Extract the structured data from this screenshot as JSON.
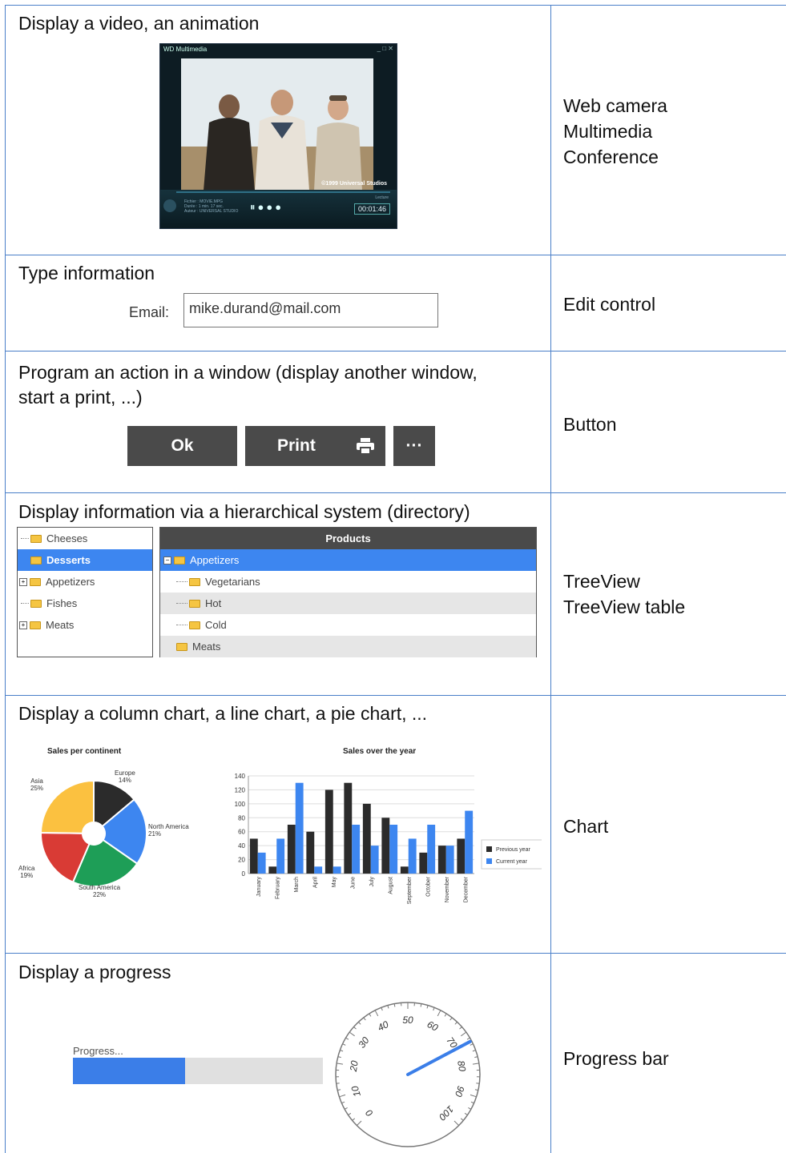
{
  "rows": [
    {
      "description": "Display a video, an animation",
      "use_lines": [
        "Web camera",
        "Multimedia",
        "Conference"
      ]
    },
    {
      "description": "Type information",
      "use_lines": [
        "Edit control"
      ]
    },
    {
      "description_lines": [
        "Program an action in a window (display another window,",
        "start a print, ...)"
      ],
      "use_lines": [
        "Button"
      ]
    },
    {
      "description": "Display information via a hierarchical system (directory)",
      "use_lines": [
        "TreeView",
        "TreeView table"
      ]
    },
    {
      "description": "Display a column chart, a line chart, a pie chart, ...",
      "use_lines": [
        "Chart"
      ]
    },
    {
      "description": "Display a progress",
      "use_lines": [
        "Progress bar"
      ]
    }
  ],
  "video_player": {
    "title": "WD Multimedia",
    "credit": "©1999 Universal Studios",
    "info_lines": [
      "Fichier : MOVIE.MPG",
      "Durée : 1 min. 17 sec.",
      "Auteur : UNIVERSAL STUDIO"
    ],
    "time_caption": "Lecture",
    "time": "00:01:46"
  },
  "email": {
    "label": "Email:",
    "value": "mike.durand@mail.com"
  },
  "buttons": {
    "ok": "Ok",
    "print": "Print",
    "more": "···"
  },
  "treeview": {
    "items": [
      {
        "label": "Cheeses",
        "expander": ""
      },
      {
        "label": "Desserts",
        "expander": "",
        "selected": true
      },
      {
        "label": "Appetizers",
        "expander": "+"
      },
      {
        "label": "Fishes",
        "expander": ""
      },
      {
        "label": "Meats",
        "expander": "+"
      }
    ]
  },
  "treeview_table": {
    "header": "Products",
    "rows": [
      {
        "label": "Appetizers",
        "expander": "−",
        "selected": true
      },
      {
        "label": "Vegetarians"
      },
      {
        "label": "Hot"
      },
      {
        "label": "Cold"
      },
      {
        "label": "Meats"
      }
    ]
  },
  "chart_data": [
    {
      "type": "pie",
      "title": "Sales per continent",
      "categories": [
        "Europe",
        "North America",
        "South America",
        "Africa",
        "Asia"
      ],
      "values": [
        14,
        21,
        22,
        19,
        25
      ],
      "value_labels": [
        "14%",
        "21%",
        "22%",
        "19%",
        "25%"
      ],
      "colors": [
        "#2b2b2b",
        "#3d86f0",
        "#1e9e57",
        "#d93b35",
        "#fbc140"
      ]
    },
    {
      "type": "bar",
      "title": "Sales over the year",
      "categories": [
        "January",
        "February",
        "March",
        "April",
        "May",
        "June",
        "July",
        "August",
        "September",
        "October",
        "November",
        "December"
      ],
      "series": [
        {
          "name": "Previous year",
          "color": "#2b2b2b",
          "values": [
            50,
            10,
            70,
            60,
            120,
            130,
            100,
            80,
            10,
            30,
            40,
            50
          ]
        },
        {
          "name": "Current year",
          "color": "#3d86f0",
          "values": [
            30,
            50,
            130,
            10,
            10,
            70,
            40,
            70,
            50,
            70,
            40,
            90
          ]
        }
      ],
      "ylim": [
        0,
        140
      ],
      "yticks": [
        "0",
        "20",
        "40",
        "60",
        "80",
        "100",
        "120",
        "140"
      ],
      "grid": true,
      "legend": "right"
    }
  ],
  "progress": {
    "label": "Progress...",
    "value": 0.45
  },
  "gauge": {
    "tick_labels": [
      "0",
      "10",
      "20",
      "30",
      "40",
      "50",
      "60",
      "70",
      "80",
      "90",
      "100"
    ],
    "value": 73,
    "needle_color": "#3b7ee8"
  }
}
